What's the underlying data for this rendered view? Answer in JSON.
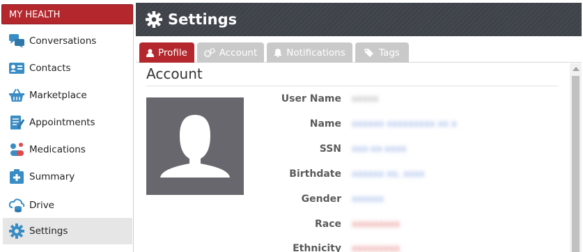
{
  "sidebar": {
    "header": "MY HEALTH",
    "items": [
      {
        "label": "Conversations",
        "icon": "conversations-icon"
      },
      {
        "label": "Contacts",
        "icon": "contacts-icon"
      },
      {
        "label": "Marketplace",
        "icon": "basket-icon"
      },
      {
        "label": "Appointments",
        "icon": "appointments-icon"
      },
      {
        "label": "Medications",
        "icon": "pills-icon"
      },
      {
        "label": "Summary",
        "icon": "medical-kit-icon"
      },
      {
        "label": "Drive",
        "icon": "cloud-drive-icon"
      },
      {
        "label": "Settings",
        "icon": "gear-icon",
        "active": true
      }
    ]
  },
  "header": {
    "title": "Settings",
    "icon": "gear-icon"
  },
  "tabs": [
    {
      "label": "Profile",
      "icon": "user-icon",
      "active": true
    },
    {
      "label": "Account",
      "icon": "gears-icon"
    },
    {
      "label": "Notifications",
      "icon": "bell-icon"
    },
    {
      "label": "Tags",
      "icon": "tags-icon"
    }
  ],
  "account": {
    "section_title": "Account",
    "fields": [
      {
        "label": "User Name",
        "value": "xxxxx"
      },
      {
        "label": "Name",
        "value": "xxxxxx xxxxxxxxx xx x"
      },
      {
        "label": "SSN",
        "value": "xxx-xx-xxxx"
      },
      {
        "label": "Birthdate",
        "value": "xxxxxx xx, xxxx"
      },
      {
        "label": "Gender",
        "value": "xxxxxx"
      },
      {
        "label": "Race",
        "value": "xxxxxxxxx"
      },
      {
        "label": "Ethnicity",
        "value": "xxxxxxxxx"
      }
    ]
  },
  "colors": {
    "accent": "#b3272d",
    "header_bg": "#3e4249",
    "icon_blue": "#3a8dc4",
    "tab_inactive": "#c9c9c9",
    "avatar_bg": "#67676d"
  }
}
